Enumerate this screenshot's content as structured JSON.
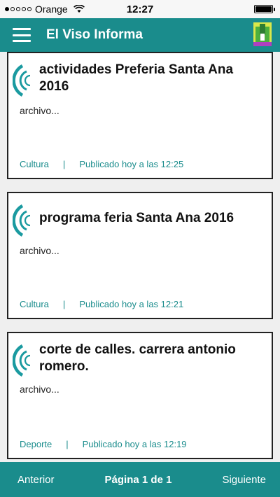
{
  "status_bar": {
    "carrier": "Orange",
    "time": "12:27"
  },
  "header": {
    "title": "El Viso Informa"
  },
  "posts": [
    {
      "title": "actividades Preferia Santa Ana 2016",
      "excerpt": "archivo...",
      "category": "Cultura",
      "separator": "|",
      "published": "Publicado hoy a las 12:25"
    },
    {
      "title": "programa feria Santa Ana 2016",
      "excerpt": "archivo...",
      "category": "Cultura",
      "separator": "|",
      "published": "Publicado hoy a las 12:21"
    },
    {
      "title": "corte de calles. carrera antonio romero.",
      "excerpt": "archivo...",
      "category": "Deporte",
      "separator": "|",
      "published": "Publicado hoy a las 12:19"
    }
  ],
  "pagination": {
    "previous_label": "Anterior",
    "page_label": "Página 1 de 1",
    "next_label": "Siguiente"
  },
  "colors": {
    "accent": "#1a8c8c"
  }
}
